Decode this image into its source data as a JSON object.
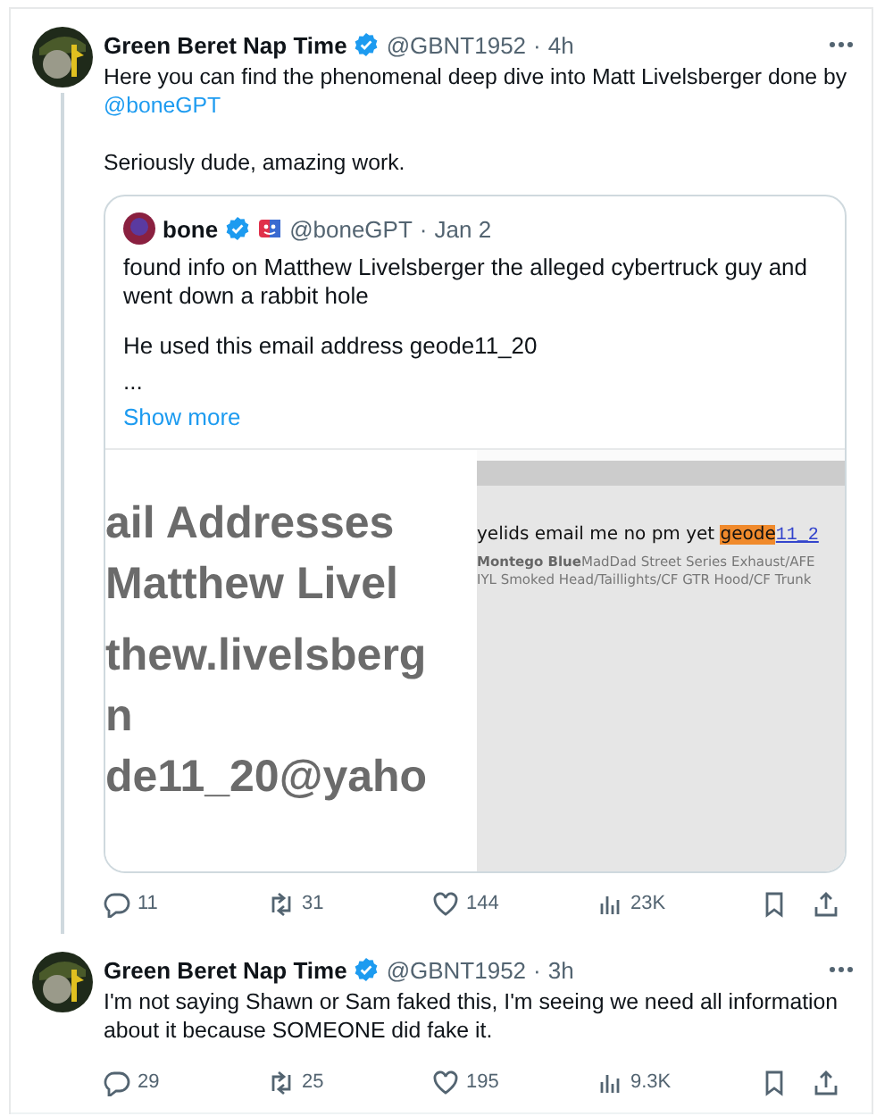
{
  "tweets": [
    {
      "author": "Green Beret Nap Time",
      "verified": true,
      "handle": "@GBNT1952",
      "separator": "·",
      "time": "4h",
      "thread_line": true,
      "paragraphs": [
        {
          "text": "Here you can find the phenomenal deep dive into Matt Livelsberger done by",
          "link": "@boneGPT"
        },
        {
          "text": "Seriously dude, amazing work."
        }
      ],
      "quote": {
        "author": "bone",
        "verified": true,
        "emoji_badge": true,
        "handle": "@boneGPT",
        "separator": "·",
        "time": "Jan 2",
        "paragraphs": [
          "found info on Matthew Livelsberger the alleged cybertruck guy and went down a rabbit hole",
          "He used this email address geode11_20",
          "..."
        ],
        "show_more": "Show more",
        "media": [
          {
            "kind": "document",
            "lines": [
              "ail Addresses",
              "Matthew Livel",
              "thew.livelsberg",
              "n",
              "de11_20@yaho"
            ]
          },
          {
            "kind": "forum",
            "line": {
              "text": "yelids email me no pm yet",
              "highlight": "geode",
              "link": "11_2"
            },
            "details": [
              {
                "bold": "Montego Blue",
                "text": "MadDad Street Series Exhaust/AFE"
              },
              {
                "text": "IYL Smoked Head/Taillights/CF GTR Hood/CF Trunk"
              }
            ]
          }
        ]
      },
      "actions": [
        {
          "kind": "reply",
          "count": "11"
        },
        {
          "kind": "repost",
          "count": "31"
        },
        {
          "kind": "like",
          "count": "144"
        },
        {
          "kind": "views",
          "count": "23K"
        },
        {
          "kind": "bookmark"
        },
        {
          "kind": "share"
        }
      ]
    },
    {
      "author": "Green Beret Nap Time",
      "verified": true,
      "handle": "@GBNT1952",
      "separator": "·",
      "time": "3h",
      "paragraphs": [
        {
          "text": "I'm not saying Shawn or Sam faked this, I'm seeing we need all information about it because SOMEONE did fake it."
        }
      ],
      "actions": [
        {
          "kind": "reply",
          "count": "29"
        },
        {
          "kind": "repost",
          "count": "25"
        },
        {
          "kind": "like",
          "count": "195"
        },
        {
          "kind": "views",
          "count": "9.3K"
        },
        {
          "kind": "bookmark"
        },
        {
          "kind": "share"
        }
      ]
    }
  ]
}
